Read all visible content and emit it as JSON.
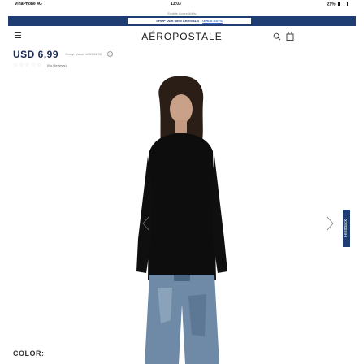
{
  "status_bar": {
    "carrier": "VinaPhone 4G",
    "time": "13:03",
    "battery": "21%"
  },
  "accessibility_link": "Enable Accessibility",
  "promo": {
    "text": "SHOP OUR NEW ARRIVALS",
    "link": "GIRLS GUYS"
  },
  "header": {
    "brand": "AÉROPOSTALE",
    "icons": [
      "menu-icon",
      "search-icon",
      "bag-icon"
    ]
  },
  "product": {
    "price": "USD 6,99",
    "comp_value": "Comp. Value: USD 34.95",
    "reviews_label": "(No Reviews)",
    "stars": "☆☆☆☆☆",
    "color_label": "COLOR:"
  },
  "feedback_label": "Feedback",
  "colors": {
    "brand_navy": "#1f3c73",
    "price_navy": "#1b2a55"
  }
}
